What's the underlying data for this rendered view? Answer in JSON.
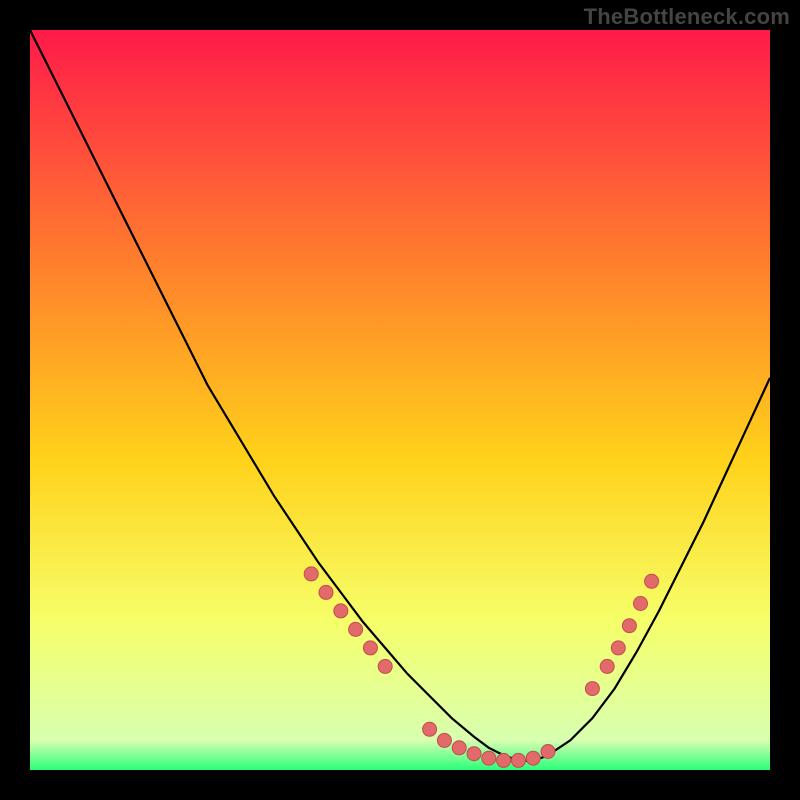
{
  "watermark": "TheBottleneck.com",
  "colors": {
    "bg": "#000000",
    "grad_top": "#ff1a4a",
    "grad_mid1": "#ff6a2a",
    "grad_mid2": "#ffd21a",
    "grad_mid3": "#f6ff6a",
    "grad_bot": "#2aff7a",
    "curve": "#000000",
    "dot_fill": "#e26a6a",
    "dot_stroke": "#c24d4d"
  },
  "chart_data": {
    "type": "line",
    "title": "",
    "xlabel": "",
    "ylabel": "",
    "xlim": [
      0,
      100
    ],
    "ylim": [
      0,
      100
    ],
    "series": [
      {
        "name": "curve",
        "x": [
          0,
          3,
          6,
          9,
          12,
          15,
          18,
          21,
          24,
          27,
          30,
          33,
          36,
          39,
          42,
          45,
          48,
          51,
          54,
          57,
          60,
          62,
          64,
          66,
          68,
          70,
          73,
          76,
          79,
          82,
          85,
          88,
          91,
          94,
          97,
          100
        ],
        "y": [
          100,
          94,
          88,
          82,
          76,
          70,
          64,
          58,
          52,
          47,
          42,
          37,
          32.5,
          28,
          24,
          20,
          16.5,
          13,
          10,
          7,
          4.5,
          3,
          2,
          1.3,
          1.2,
          2,
          4,
          7,
          11,
          16,
          21.5,
          27.5,
          33.5,
          40,
          46.5,
          53
        ]
      }
    ],
    "dots_left": [
      {
        "x": 38,
        "y": 26.5
      },
      {
        "x": 40,
        "y": 24
      },
      {
        "x": 42,
        "y": 21.5
      },
      {
        "x": 44,
        "y": 19
      },
      {
        "x": 46,
        "y": 16.5
      },
      {
        "x": 48,
        "y": 14
      }
    ],
    "dots_bottom": [
      {
        "x": 54,
        "y": 5.5
      },
      {
        "x": 56,
        "y": 4
      },
      {
        "x": 58,
        "y": 3
      },
      {
        "x": 60,
        "y": 2.2
      },
      {
        "x": 62,
        "y": 1.6
      },
      {
        "x": 64,
        "y": 1.3
      },
      {
        "x": 66,
        "y": 1.3
      },
      {
        "x": 68,
        "y": 1.6
      },
      {
        "x": 70,
        "y": 2.5
      }
    ],
    "dots_right": [
      {
        "x": 76,
        "y": 11
      },
      {
        "x": 78,
        "y": 14
      },
      {
        "x": 79.5,
        "y": 16.5
      },
      {
        "x": 81,
        "y": 19.5
      },
      {
        "x": 82.5,
        "y": 22.5
      },
      {
        "x": 84,
        "y": 25.5
      }
    ]
  }
}
